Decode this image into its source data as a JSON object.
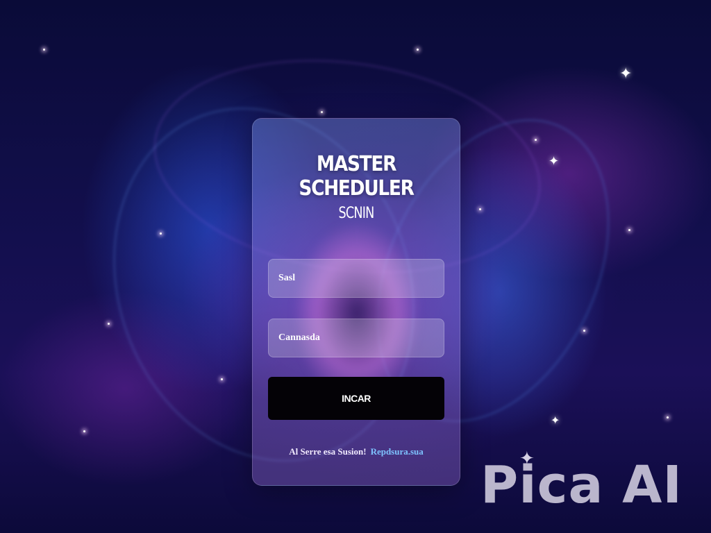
{
  "app": {
    "title": "MASTER SCHEDULER",
    "subtitle": "SCNIN"
  },
  "form": {
    "username": {
      "placeholder": "Sasl"
    },
    "password": {
      "placeholder": "Cannasda"
    },
    "submit_label": "INCAR",
    "footer_text": "Al Serre esa Susion!",
    "footer_link": "Repdsura.sua"
  },
  "watermark": {
    "text": "Pica AI"
  },
  "icons": {
    "sparkle": "sparkle-icon"
  },
  "colors": {
    "background": "#0b0d3a",
    "card": "rgba(130,130,225,0.4)",
    "button": "#040206",
    "link": "#7ec3ff"
  }
}
